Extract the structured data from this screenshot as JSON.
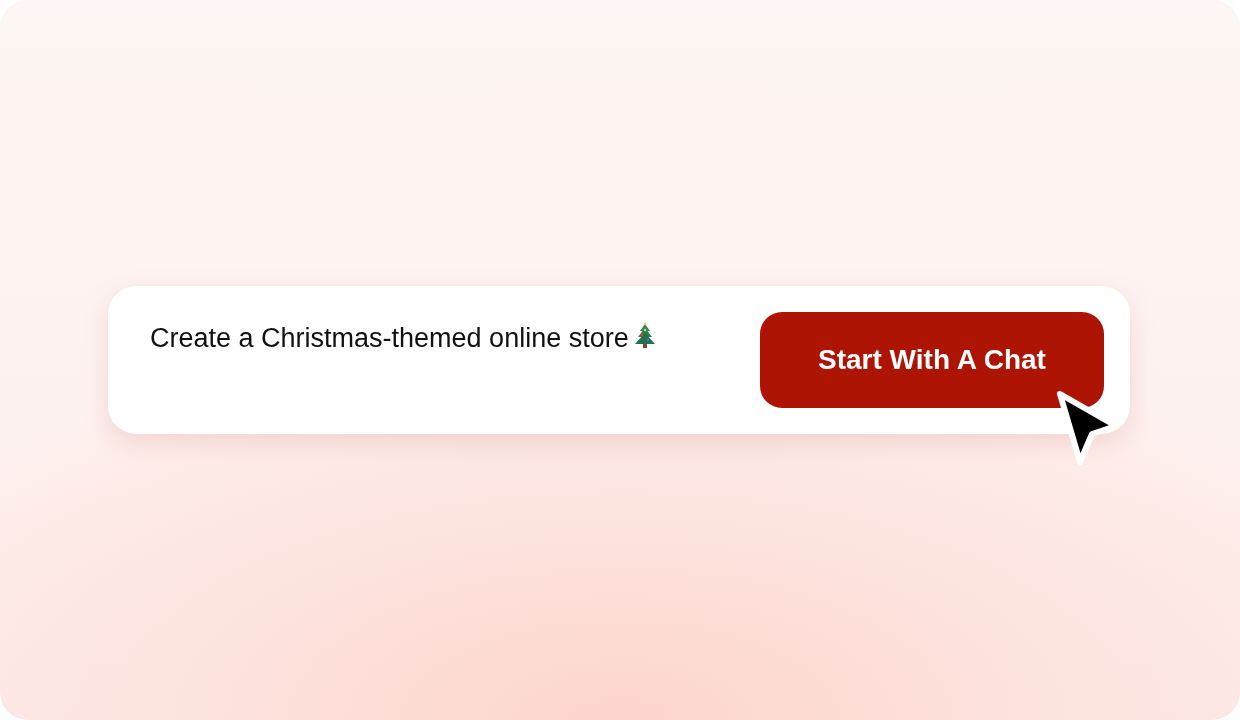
{
  "prompt": {
    "text": "Create a Christmas-themed online store"
  },
  "button": {
    "label": "Start With A Chat"
  }
}
